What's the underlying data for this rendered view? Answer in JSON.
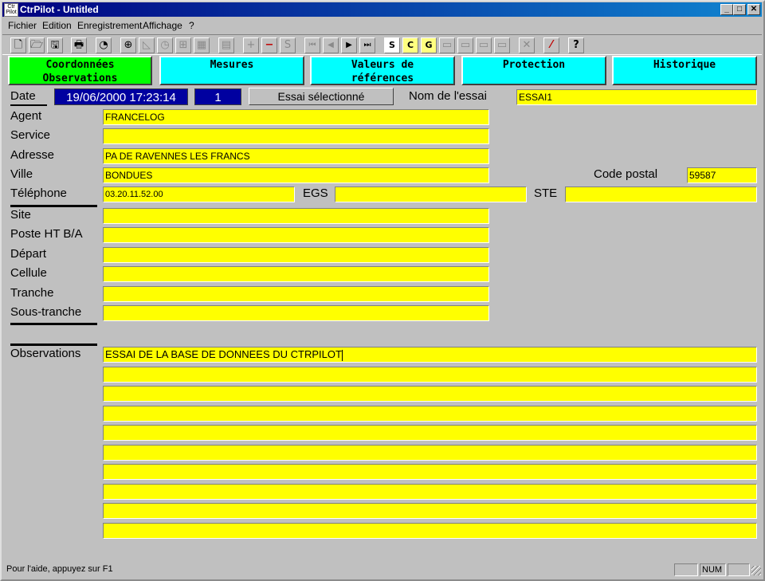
{
  "window": {
    "title": "CtrPilot - Untitled",
    "minimize": "_",
    "maximize": "□",
    "close": "✕"
  },
  "menu": [
    "Fichier",
    "Edition",
    "Enregistrement",
    "Affichage",
    "?"
  ],
  "toolbar": {
    "icons": [
      "new-icon",
      "open-icon",
      "save-icon",
      "print-icon",
      "gauge-icon",
      "crosshair-icon",
      "chart-icon",
      "clock-icon",
      "grid-icon",
      "table-icon",
      "notes-icon",
      "plus-icon",
      "minus-icon",
      "s-icon",
      "first-record-icon",
      "prev-record-icon",
      "next-record-icon",
      "last-record-icon",
      "fs-icon",
      "fc-icon",
      "fg-icon",
      "doc1-icon",
      "doc2-icon",
      "doc3-icon",
      "doc4-icon",
      "delete-icon",
      "probe-icon",
      "help-icon"
    ],
    "glyphs": [
      "🗋",
      "🗁",
      "🖫",
      "🖶",
      "◔",
      "⊕",
      "◺",
      "◷",
      "⊞",
      "▦",
      "▤",
      "+",
      "−",
      "S",
      "⏮",
      "◀",
      "▶",
      "⏭",
      "S",
      "C",
      "G",
      "▭",
      "▭",
      "▭",
      "▭",
      "✕",
      "⁄",
      "?"
    ]
  },
  "tabs": [
    {
      "label": "Coordonnées\nObservations",
      "active": true
    },
    {
      "label": "Mesures",
      "active": false
    },
    {
      "label": "Valeurs de\nréférences",
      "active": false
    },
    {
      "label": "Protection",
      "active": false
    },
    {
      "label": "Historique",
      "active": false
    }
  ],
  "header": {
    "date_label": "Date",
    "date_value": "19/06/2000  17:23:14",
    "number_value": "1",
    "selected_button": "Essai sélectionné",
    "test_name_label": "Nom de l'essai",
    "test_name_value": "ESSAI1"
  },
  "contact": {
    "agent_label": "Agent",
    "agent_value": "FRANCELOG",
    "service_label": "Service",
    "service_value": "",
    "adresse_label": "Adresse",
    "adresse_value": "PA DE RAVENNES LES FRANCS",
    "ville_label": "Ville",
    "ville_value": "BONDUES",
    "code_postal_label": "Code postal",
    "code_postal_value": "59587",
    "telephone_label": "Téléphone",
    "telephone_value": "03.20.11.52.00",
    "egs_label": "EGS",
    "egs_value": "",
    "ste_label": "STE",
    "ste_value": ""
  },
  "site": {
    "site_label": "Site",
    "site_value": "",
    "poste_label": "Poste HT B/A",
    "poste_value": "",
    "depart_label": "Départ",
    "depart_value": "",
    "cellule_label": "Cellule",
    "cellule_value": "",
    "tranche_label": "Tranche",
    "tranche_value": "",
    "sous_tranche_label": "Sous-tranche",
    "sous_tranche_value": ""
  },
  "observations": {
    "label": "Observations",
    "lines": [
      "ESSAI DE LA BASE DE DONNEES DU CTRPILOT",
      "",
      "",
      "",
      "",
      "",
      "",
      "",
      "",
      ""
    ]
  },
  "status": {
    "help_text": "Pour l'aide, appuyez sur F1",
    "pane1": "",
    "num": "NUM",
    "pane3": ""
  },
  "colors": {
    "field": "#ffff00",
    "tab": "#00ffff",
    "tab_active": "#00ff00",
    "titlebar": "#000080",
    "date_box": "#0000a0"
  }
}
